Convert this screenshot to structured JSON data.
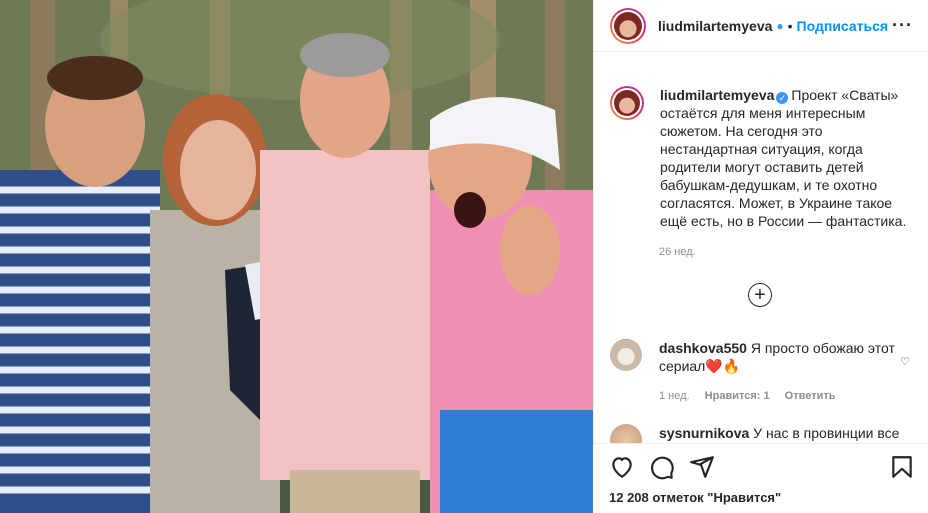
{
  "post": {
    "username": "liudmilartemyeva",
    "follow_label": "Подписаться",
    "header_dot": "•",
    "more_icon": "more-horizontal-icon",
    "caption_text": "Проект «Сваты» остаётся для меня интересным сюжетом. На сегодня это нестандартная ситуация, когда родители могут оставить детей бабушкам-дедушкам, и те охотно согласятся. Может, в Украине такое ещё есть, но в России — фантастика.",
    "caption_time": "26 нед.",
    "load_more_icon": "plus-circle-icon"
  },
  "comments": [
    {
      "username": "dashkova550",
      "text": "Я просто обожаю этот сериал❤️🔥",
      "time": "1 нед.",
      "likes": "Нравится: 1",
      "reply": "Ответить"
    },
    {
      "username": "sysnurnikova",
      "text": "У нас в провинции все"
    }
  ],
  "actions": {
    "likes_count": "12 208",
    "likes_suffix": " отметок \"Нравится\"",
    "icons": [
      "heart-icon",
      "comment-icon",
      "share-icon",
      "bookmark-icon"
    ]
  },
  "colors": {
    "accent": "#0095f6",
    "text": "#262626",
    "muted": "#8e8e8e",
    "verified": "#3897f0"
  }
}
